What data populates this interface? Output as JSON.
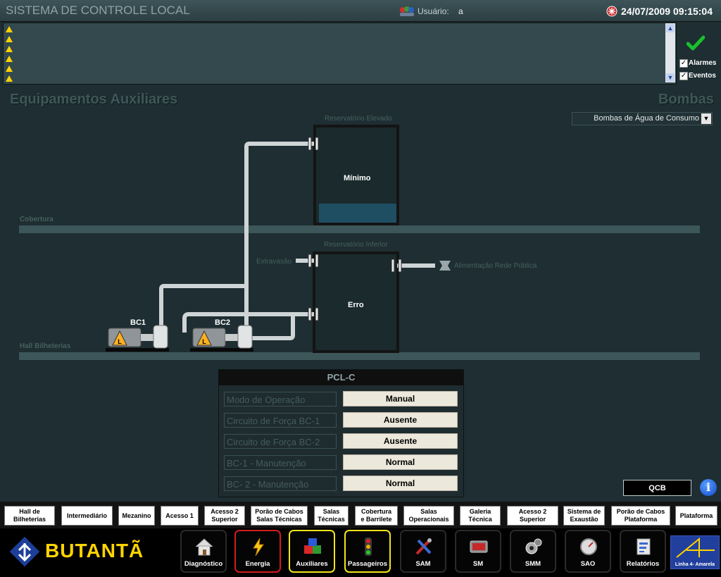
{
  "header": {
    "app_title": "SISTEMA DE CONTROLE LOCAL",
    "user_label": "Usuário:",
    "user_value": "a",
    "datetime": "24/07/2009 09:15:04"
  },
  "alarm_panel": {
    "alarms_label": "Alarmes",
    "events_label": "Eventos",
    "alarms_checked": true,
    "events_checked": true
  },
  "page": {
    "title": "Equipamentos Auxiliares",
    "section": "Bombas",
    "pump_select": "Bombas de Água de Consumo"
  },
  "diagram": {
    "upper_tank_label": "Reservatório Elevado",
    "upper_tank_status": "Mínimo",
    "upper_tank_level": 0.2,
    "lower_tank_label": "Reservatório Inferior",
    "lower_tank_status": "Erro",
    "floor_roof": "Cobertura",
    "floor_hall": "Hall Bilheterias",
    "overflow": "Extravasão",
    "public_supply": "Alimentação Rede Pública",
    "pump1": "BC1",
    "pump2": "BC2"
  },
  "pcl": {
    "title": "PCL-C",
    "rows": [
      {
        "label": "Modo de Operação",
        "value": "Manual"
      },
      {
        "label": "Circuito de Força BC-1",
        "value": "Ausente"
      },
      {
        "label": "Circuito de Força BC-2",
        "value": "Ausente"
      },
      {
        "label": "BC-1 - Manutenção",
        "value": "Normal"
      },
      {
        "label": "BC- 2 - Manutenção",
        "value": "Normal"
      }
    ]
  },
  "qcb": "QCB",
  "info_icon_glyph": "i",
  "nav": [
    "Hall de\nBilheterias",
    "Intermediário",
    "Mezanino",
    "Acesso 1",
    "Acesso 2\nSuperior",
    "Porão de Cabos\nSalas Técnicas",
    "Salas\nTécnicas",
    "Cobertura\ne Barrilete",
    "Salas\nOperacionais",
    "Galeria\nTécnica",
    "Acesso 2\nSuperior",
    "Sistema de\nExaustão",
    "Porão de Cabos\nPlataforma",
    "Plataforma"
  ],
  "station": "BUTANTÃ",
  "modules": [
    "Diagnóstico",
    "Energia",
    "Auxiliares",
    "Passageiros",
    "SAM",
    "SM",
    "SMM",
    "SAO",
    "Relatórios"
  ],
  "line_label": "Linha 4- Amarela",
  "colors": {
    "energia_border": "#d11c1c",
    "auxiliares_border": "#f2e51b",
    "passageiros_border": "#f2e51b",
    "water": "#1f4e63"
  }
}
